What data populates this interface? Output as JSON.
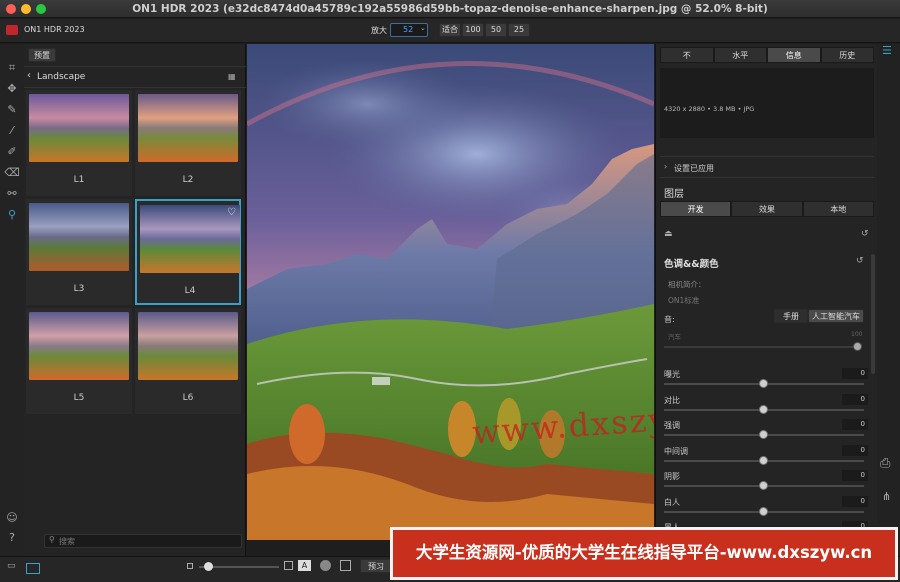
{
  "window": {
    "title": "ON1 HDR 2023 (e32dc8474d0a45789c192a55986d59bb-topaz-denoise-enhance-sharpen.jpg @ 52.0% 8-bit)"
  },
  "toolbar": {
    "app_name": "ON1 HDR 2023",
    "zoom_label": "放大",
    "zoom_value": "52",
    "fit_label": "适合",
    "zoom_presets": [
      "100",
      "50",
      "25"
    ]
  },
  "left_panel": {
    "presets_button": "预置",
    "category": "Landscape",
    "thumbnails": [
      {
        "label": "L1",
        "favorite": false
      },
      {
        "label": "L2",
        "favorite": false
      },
      {
        "label": "L3",
        "favorite": false
      },
      {
        "label": "L4",
        "favorite": true
      },
      {
        "label": "L5",
        "favorite": false
      },
      {
        "label": "L6",
        "favorite": false
      }
    ],
    "search_placeholder": "搜索"
  },
  "right_panel": {
    "tabs": [
      "不",
      "水平",
      "信息",
      "历史"
    ],
    "active_tab": "信息",
    "info_text": "4320 x 2880 • 3.8 MB • JPG",
    "settings_applied": "设置已应用",
    "layers_title": "图层",
    "layer_tabs": [
      "开发",
      "效果",
      "本地"
    ],
    "active_layer_tab": "开发",
    "section_title": "色调&&颜色",
    "camera_profile_label": "相机简介：",
    "camera_profile_value": "ON1标准",
    "tone_label": "音:",
    "tone_modes": [
      "手册",
      "人工智能汽车"
    ],
    "auto_label": "汽车",
    "auto_value": "100",
    "sliders": [
      {
        "label": "曝光",
        "value": "0"
      },
      {
        "label": "对比",
        "value": "0"
      },
      {
        "label": "强调",
        "value": "0"
      },
      {
        "label": "中间调",
        "value": "0"
      },
      {
        "label": "阴影",
        "value": "0"
      },
      {
        "label": "白人",
        "value": "0"
      },
      {
        "label": "黑人",
        "value": "0"
      }
    ]
  },
  "bottom_bar": {
    "preview_button": "预习"
  },
  "overlay": {
    "watermark": "www.dxszyw.cn",
    "banner": "大学生资源网-优质的大学生在线指导平台-www.dxszyw.cn"
  },
  "colors": {
    "accent": "#3aa0c8",
    "banner": "#c8301d",
    "panel": "#242424"
  }
}
